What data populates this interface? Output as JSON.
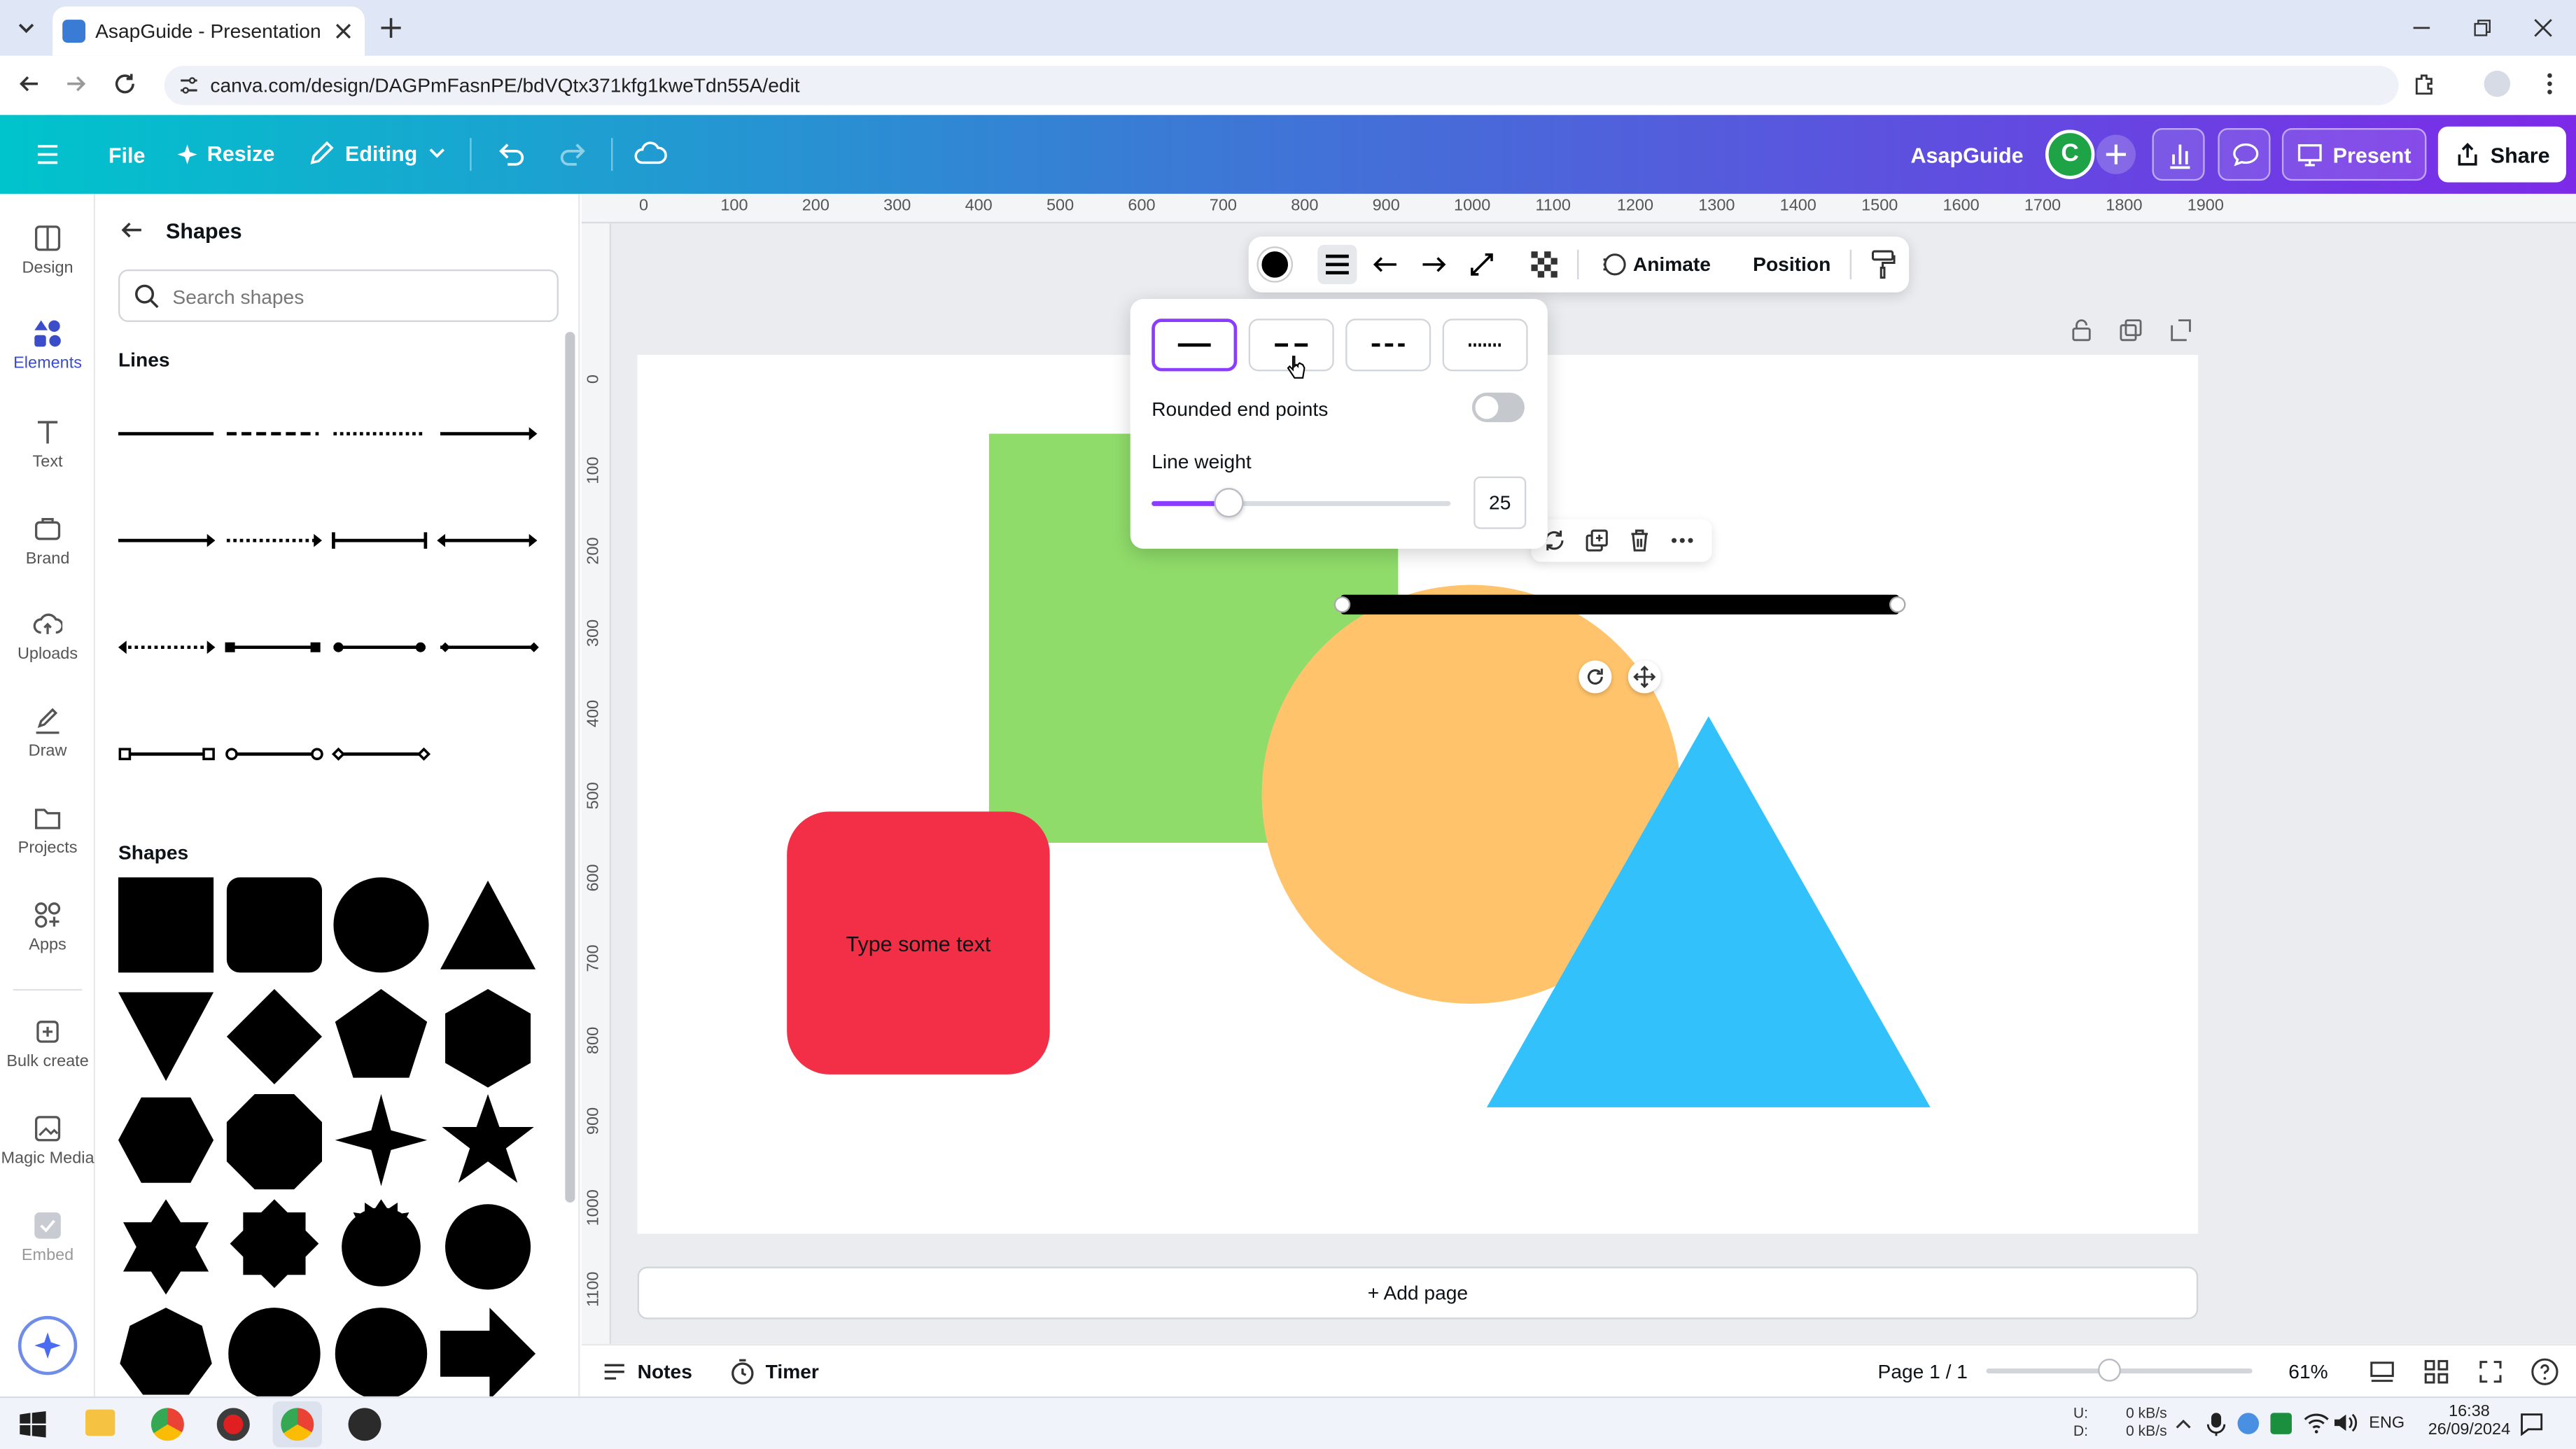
{
  "browser": {
    "tab_title": "AsapGuide - Presentation",
    "url": "canva.com/design/DAGPmFasnPE/bdVQtx371kfg1kweTdn55A/edit"
  },
  "topbar": {
    "file": "File",
    "resize": "Resize",
    "editing": "Editing",
    "design_name": "AsapGuide",
    "avatar_initial": "C",
    "present": "Present",
    "share": "Share"
  },
  "rail": [
    {
      "label": "Design",
      "icon": "design-icon"
    },
    {
      "label": "Elements",
      "icon": "elements-icon"
    },
    {
      "label": "Text",
      "icon": "text-icon"
    },
    {
      "label": "Brand",
      "icon": "brand-icon"
    },
    {
      "label": "Uploads",
      "icon": "uploads-icon"
    },
    {
      "label": "Draw",
      "icon": "draw-icon"
    },
    {
      "label": "Projects",
      "icon": "projects-icon"
    },
    {
      "label": "Apps",
      "icon": "apps-icon"
    },
    {
      "label": "Bulk create",
      "icon": "bulk-create-icon"
    },
    {
      "label": "Magic Media",
      "icon": "magic-media-icon"
    },
    {
      "label": "Embed",
      "icon": "embed-icon"
    }
  ],
  "panel": {
    "title": "Shapes",
    "search_placeholder": "Search shapes",
    "lines_title": "Lines",
    "shapes_title": "Shapes"
  },
  "float_toolbar": {
    "animate": "Animate",
    "position": "Position"
  },
  "line_popover": {
    "rounded_label": "Rounded end points",
    "rounded_enabled": false,
    "weight_label": "Line weight",
    "weight_value": "25",
    "weight_fraction": 0.26
  },
  "canvas": {
    "rounded_square_text": "Type some text",
    "add_page": "+ Add page",
    "ruler_top": [
      "0",
      "100",
      "200",
      "300",
      "400",
      "500",
      "600",
      "700",
      "800",
      "900",
      "1000",
      "1100",
      "1200",
      "1300",
      "1400",
      "1500",
      "1600",
      "1700",
      "1800",
      "1900"
    ],
    "ruler_left": [
      "0",
      "100",
      "200",
      "300",
      "400",
      "500",
      "600",
      "700",
      "800",
      "900",
      "1000",
      "1100"
    ],
    "colors": {
      "green": "#8fdc6a",
      "orange": "#ffc46b",
      "red": "#f22f46",
      "blue": "#33c1fb"
    }
  },
  "bottom": {
    "notes": "Notes",
    "timer": "Timer",
    "page": "Page 1 / 1",
    "zoom": "61%",
    "zoom_fraction": 0.46
  },
  "taskbar": {
    "net_up_label": "U:",
    "net_down_label": "D:",
    "net_up": "0 kB/s",
    "net_down": "0 kB/s",
    "lang": "ENG",
    "time": "16:38",
    "date": "26/09/2024"
  }
}
